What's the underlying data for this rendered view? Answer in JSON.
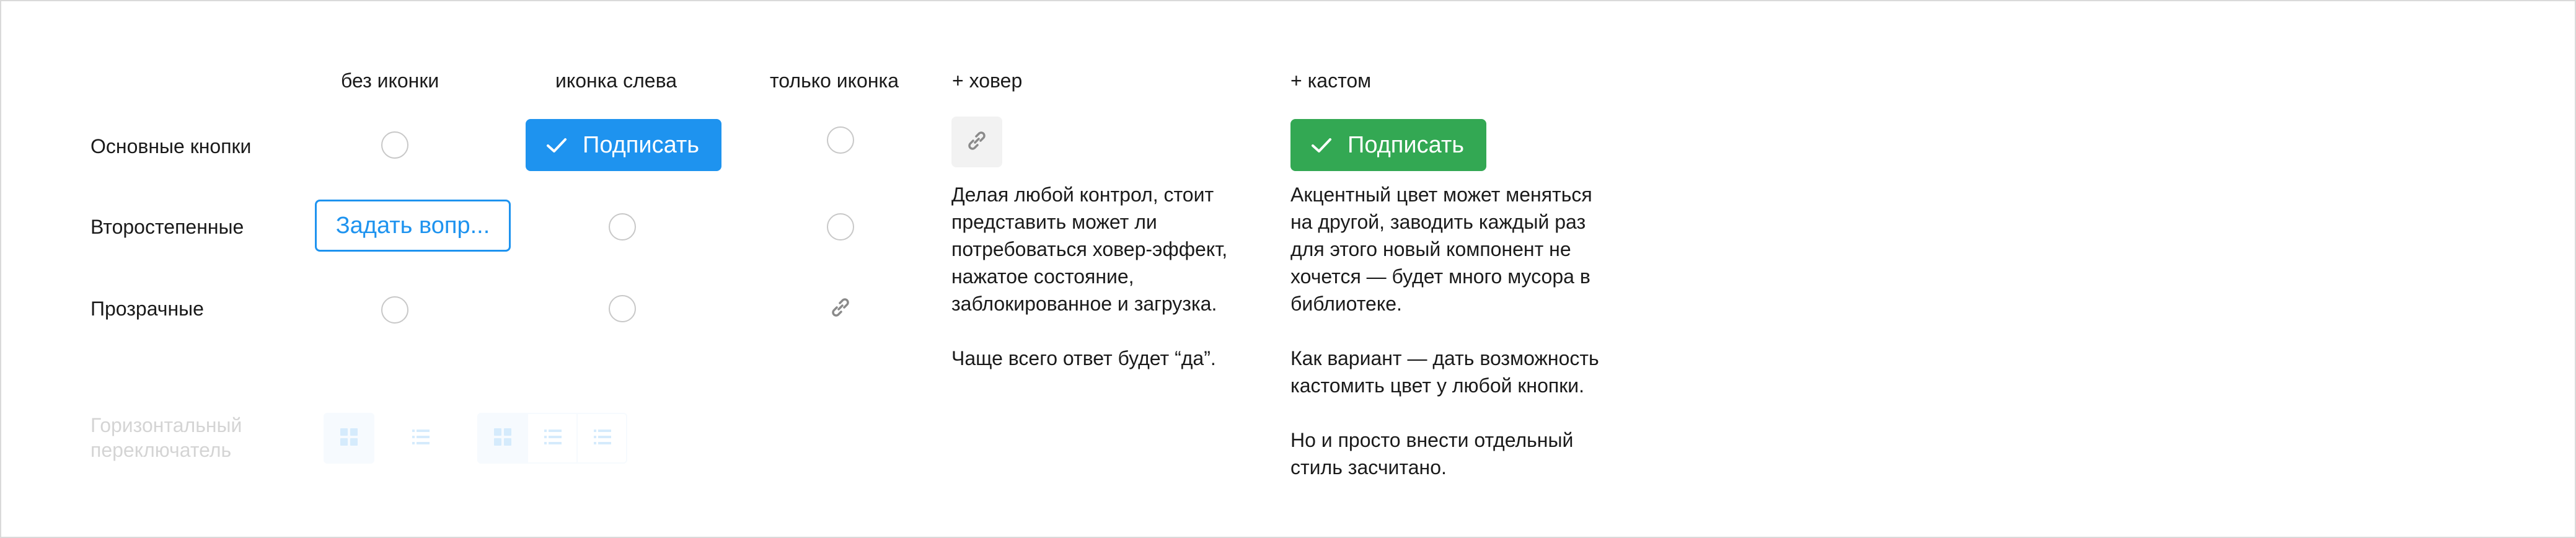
{
  "columns": {
    "no_icon": "без иконки",
    "icon_left": "иконка слева",
    "icon_only": "только иконка",
    "hover": "+ ховер",
    "custom": "+ кастом"
  },
  "rows": {
    "primary": "Основные кнопки",
    "secondary": "Второстепенные",
    "transparent": "Прозрачные"
  },
  "buttons": {
    "primary_label": "Подписать",
    "secondary_label": "Задать вопр...",
    "custom_label": "Подписать"
  },
  "colors": {
    "primary": "#1e93ef",
    "custom": "#33a853",
    "secondary_border": "#1e93ef"
  },
  "hover_text": {
    "p1": "Делая любой контрол, стоит представить может ли потребоваться ховер-эффект, нажатое состояние, заблокированное и загрузка.",
    "p2": "Чаще всего ответ будет “да”."
  },
  "custom_text": {
    "p1": "Акцентный цвет может меняться на другой, заводить каждый раз для этого новый компонент не хочется — будет много мусора в библиотеке.",
    "p2": "Как вариант — дать возможность кастомить цвет у любой кнопки.",
    "p3": "Но и просто внести отдельный стиль засчитано."
  },
  "switch": {
    "label": "Горизонтальный переключатель"
  },
  "icons": [
    "check-icon",
    "link-icon",
    "grid-icon",
    "list-icon"
  ]
}
